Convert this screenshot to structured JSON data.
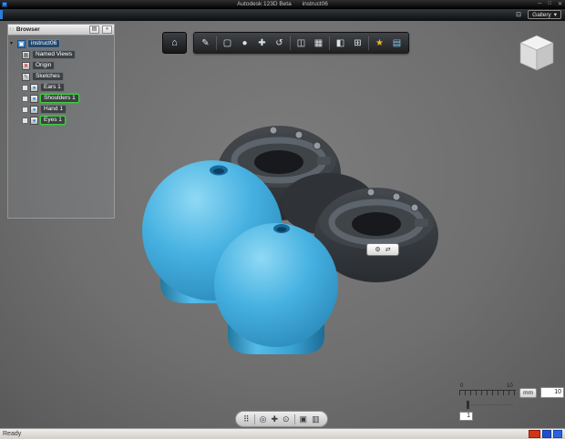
{
  "window": {
    "app_title": "Autodesk 123D Beta",
    "doc_title": "instruct06",
    "minimize_glyph": "─",
    "maximize_glyph": "□",
    "close_glyph": "✕"
  },
  "topbar": {
    "snapshot_glyph": "⊡",
    "gallery_label": "Gallery",
    "dropdown_glyph": "▾"
  },
  "browser": {
    "title": "Browser",
    "grip_glyph": "∷",
    "layout_button_glyph": "▤",
    "collapse_button_glyph": "«",
    "root_arrow_glyph": "▾",
    "icon_glyphs": {
      "root": "▣",
      "views": "▦",
      "origin": "✕",
      "sketches": "✎",
      "part": "●"
    },
    "items": [
      {
        "label": "instruct06"
      },
      {
        "label": "Named Views"
      },
      {
        "label": "Origin"
      },
      {
        "label": "Sketches"
      },
      {
        "label": "Ears 1"
      },
      {
        "label": "Shoulders 1"
      },
      {
        "label": "Hand 1"
      },
      {
        "label": "Eyes 1"
      }
    ]
  },
  "toolbar": {
    "home_glyph": "⌂",
    "tools": [
      {
        "name": "sketch",
        "glyph": "✎"
      },
      {
        "name": "primitive-box",
        "glyph": "▢"
      },
      {
        "name": "primitive-sphere",
        "glyph": "●"
      },
      {
        "name": "move",
        "glyph": "✚"
      },
      {
        "name": "revolve",
        "glyph": "↺"
      },
      {
        "name": "mirror",
        "glyph": "◫"
      },
      {
        "name": "pattern",
        "glyph": "▦"
      },
      {
        "name": "split",
        "glyph": "◧"
      },
      {
        "name": "combine",
        "glyph": "⊞"
      },
      {
        "name": "material",
        "glyph": "★"
      },
      {
        "name": "snap",
        "glyph": "▤"
      }
    ]
  },
  "mini_toolbar": {
    "buttons": [
      {
        "name": "edit",
        "glyph": "⚙"
      },
      {
        "name": "move",
        "glyph": "⇄"
      }
    ]
  },
  "navbar": {
    "buttons": [
      {
        "name": "grip",
        "glyph": "⠿"
      },
      {
        "name": "orbit",
        "glyph": "◎"
      },
      {
        "name": "pan",
        "glyph": "✚"
      },
      {
        "name": "zoom",
        "glyph": "⊙"
      },
      {
        "name": "fit",
        "glyph": "▣"
      },
      {
        "name": "display",
        "glyph": "▥"
      }
    ]
  },
  "scale_widget": {
    "tick_min": "0",
    "tick_max": "10",
    "unit_label": "mm",
    "grid_value": "10",
    "snap_value": "1"
  },
  "statusbar": {
    "message": "Ready"
  },
  "colors": {
    "accent_blue": "#3aa5d8",
    "highlight_green": "#3ecf3e",
    "part_dark": "#34383c"
  }
}
